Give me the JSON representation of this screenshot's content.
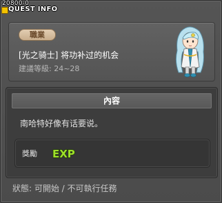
{
  "title": {
    "quest_id": "20800-0",
    "label": "QUEST INFO"
  },
  "quest": {
    "job_badge": "職業",
    "name": "[光之骑士] 将功补过的机会",
    "level_requirement": "建議等級: 24~28"
  },
  "content": {
    "header": "內容",
    "text": "南哈特好像有话要说。"
  },
  "reward": {
    "label": "獎勵",
    "icon": "exp-icon",
    "icon_text": "EXP"
  },
  "status": {
    "text": "狀態: 可開始 / 不可執行任務"
  },
  "colors": {
    "title_icon": "#f2c200",
    "badge_bg": "#d5bf9f",
    "exp_green": "#9ee02a"
  }
}
